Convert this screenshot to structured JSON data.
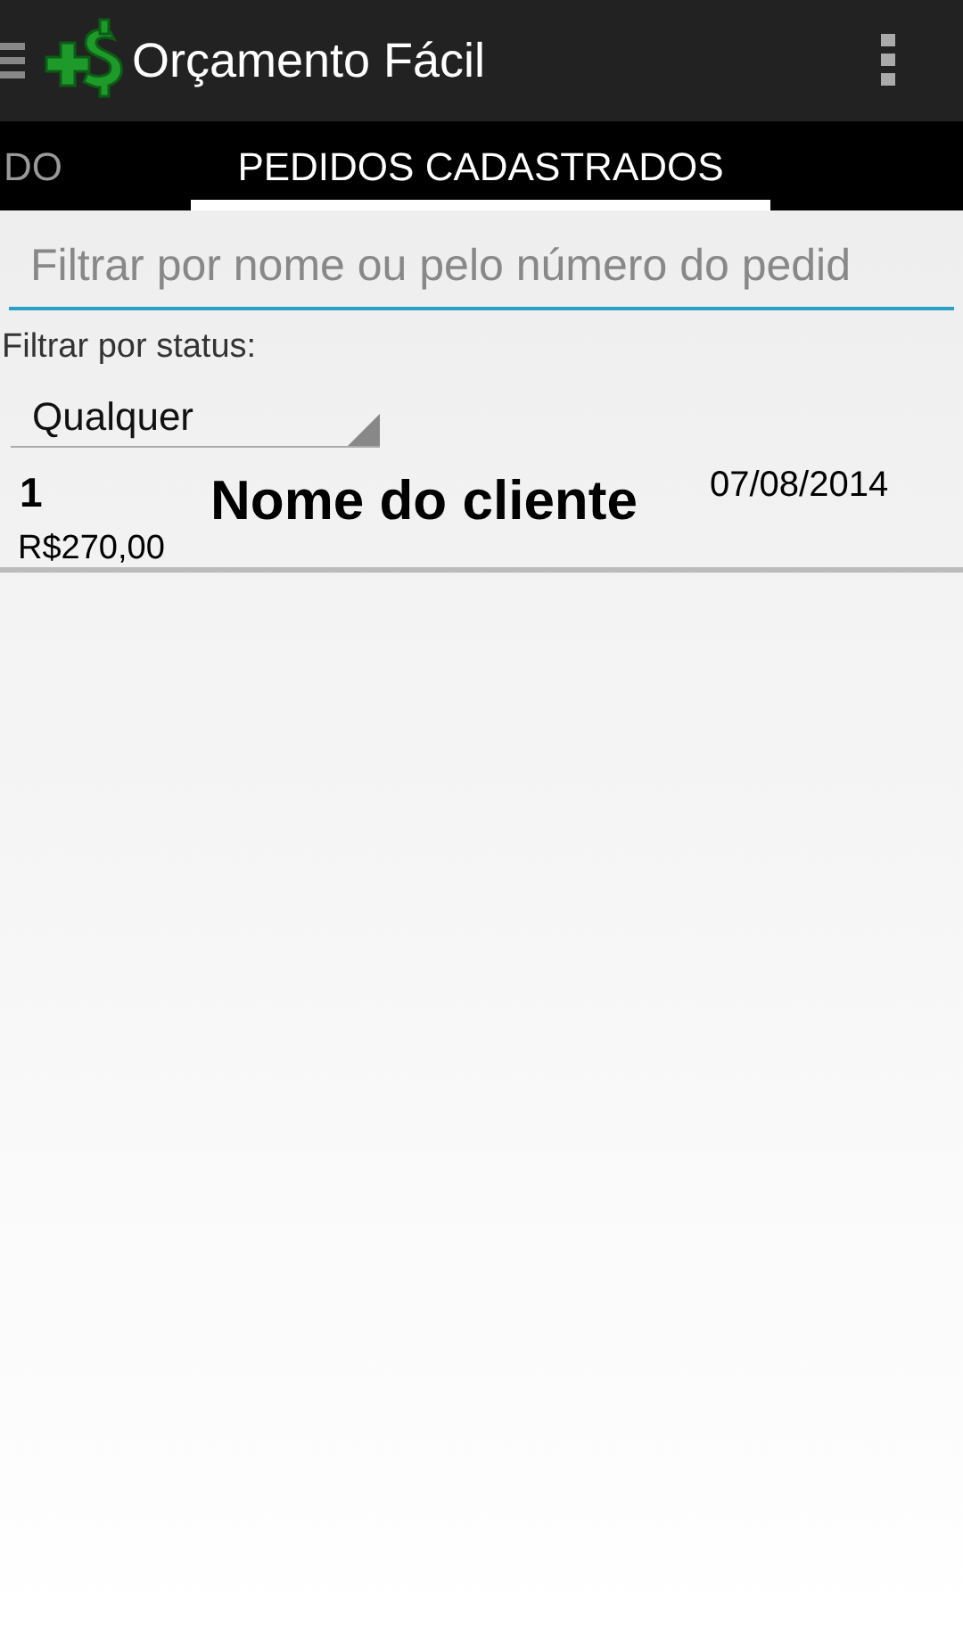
{
  "app_bar": {
    "title": "Orçamento Fácil"
  },
  "tabs": [
    {
      "label": "DO",
      "selected": false
    },
    {
      "label": "PEDIDOS CADASTRADOS",
      "selected": true
    }
  ],
  "search": {
    "placeholder": "Filtrar por nome ou pelo número do pedid"
  },
  "status_filter": {
    "label": "Filtrar por status:",
    "value": "Qualquer"
  },
  "orders": [
    {
      "number": "1",
      "client": "Nome do cliente",
      "date": "07/08/2014",
      "total": "R$270,00"
    }
  ]
}
